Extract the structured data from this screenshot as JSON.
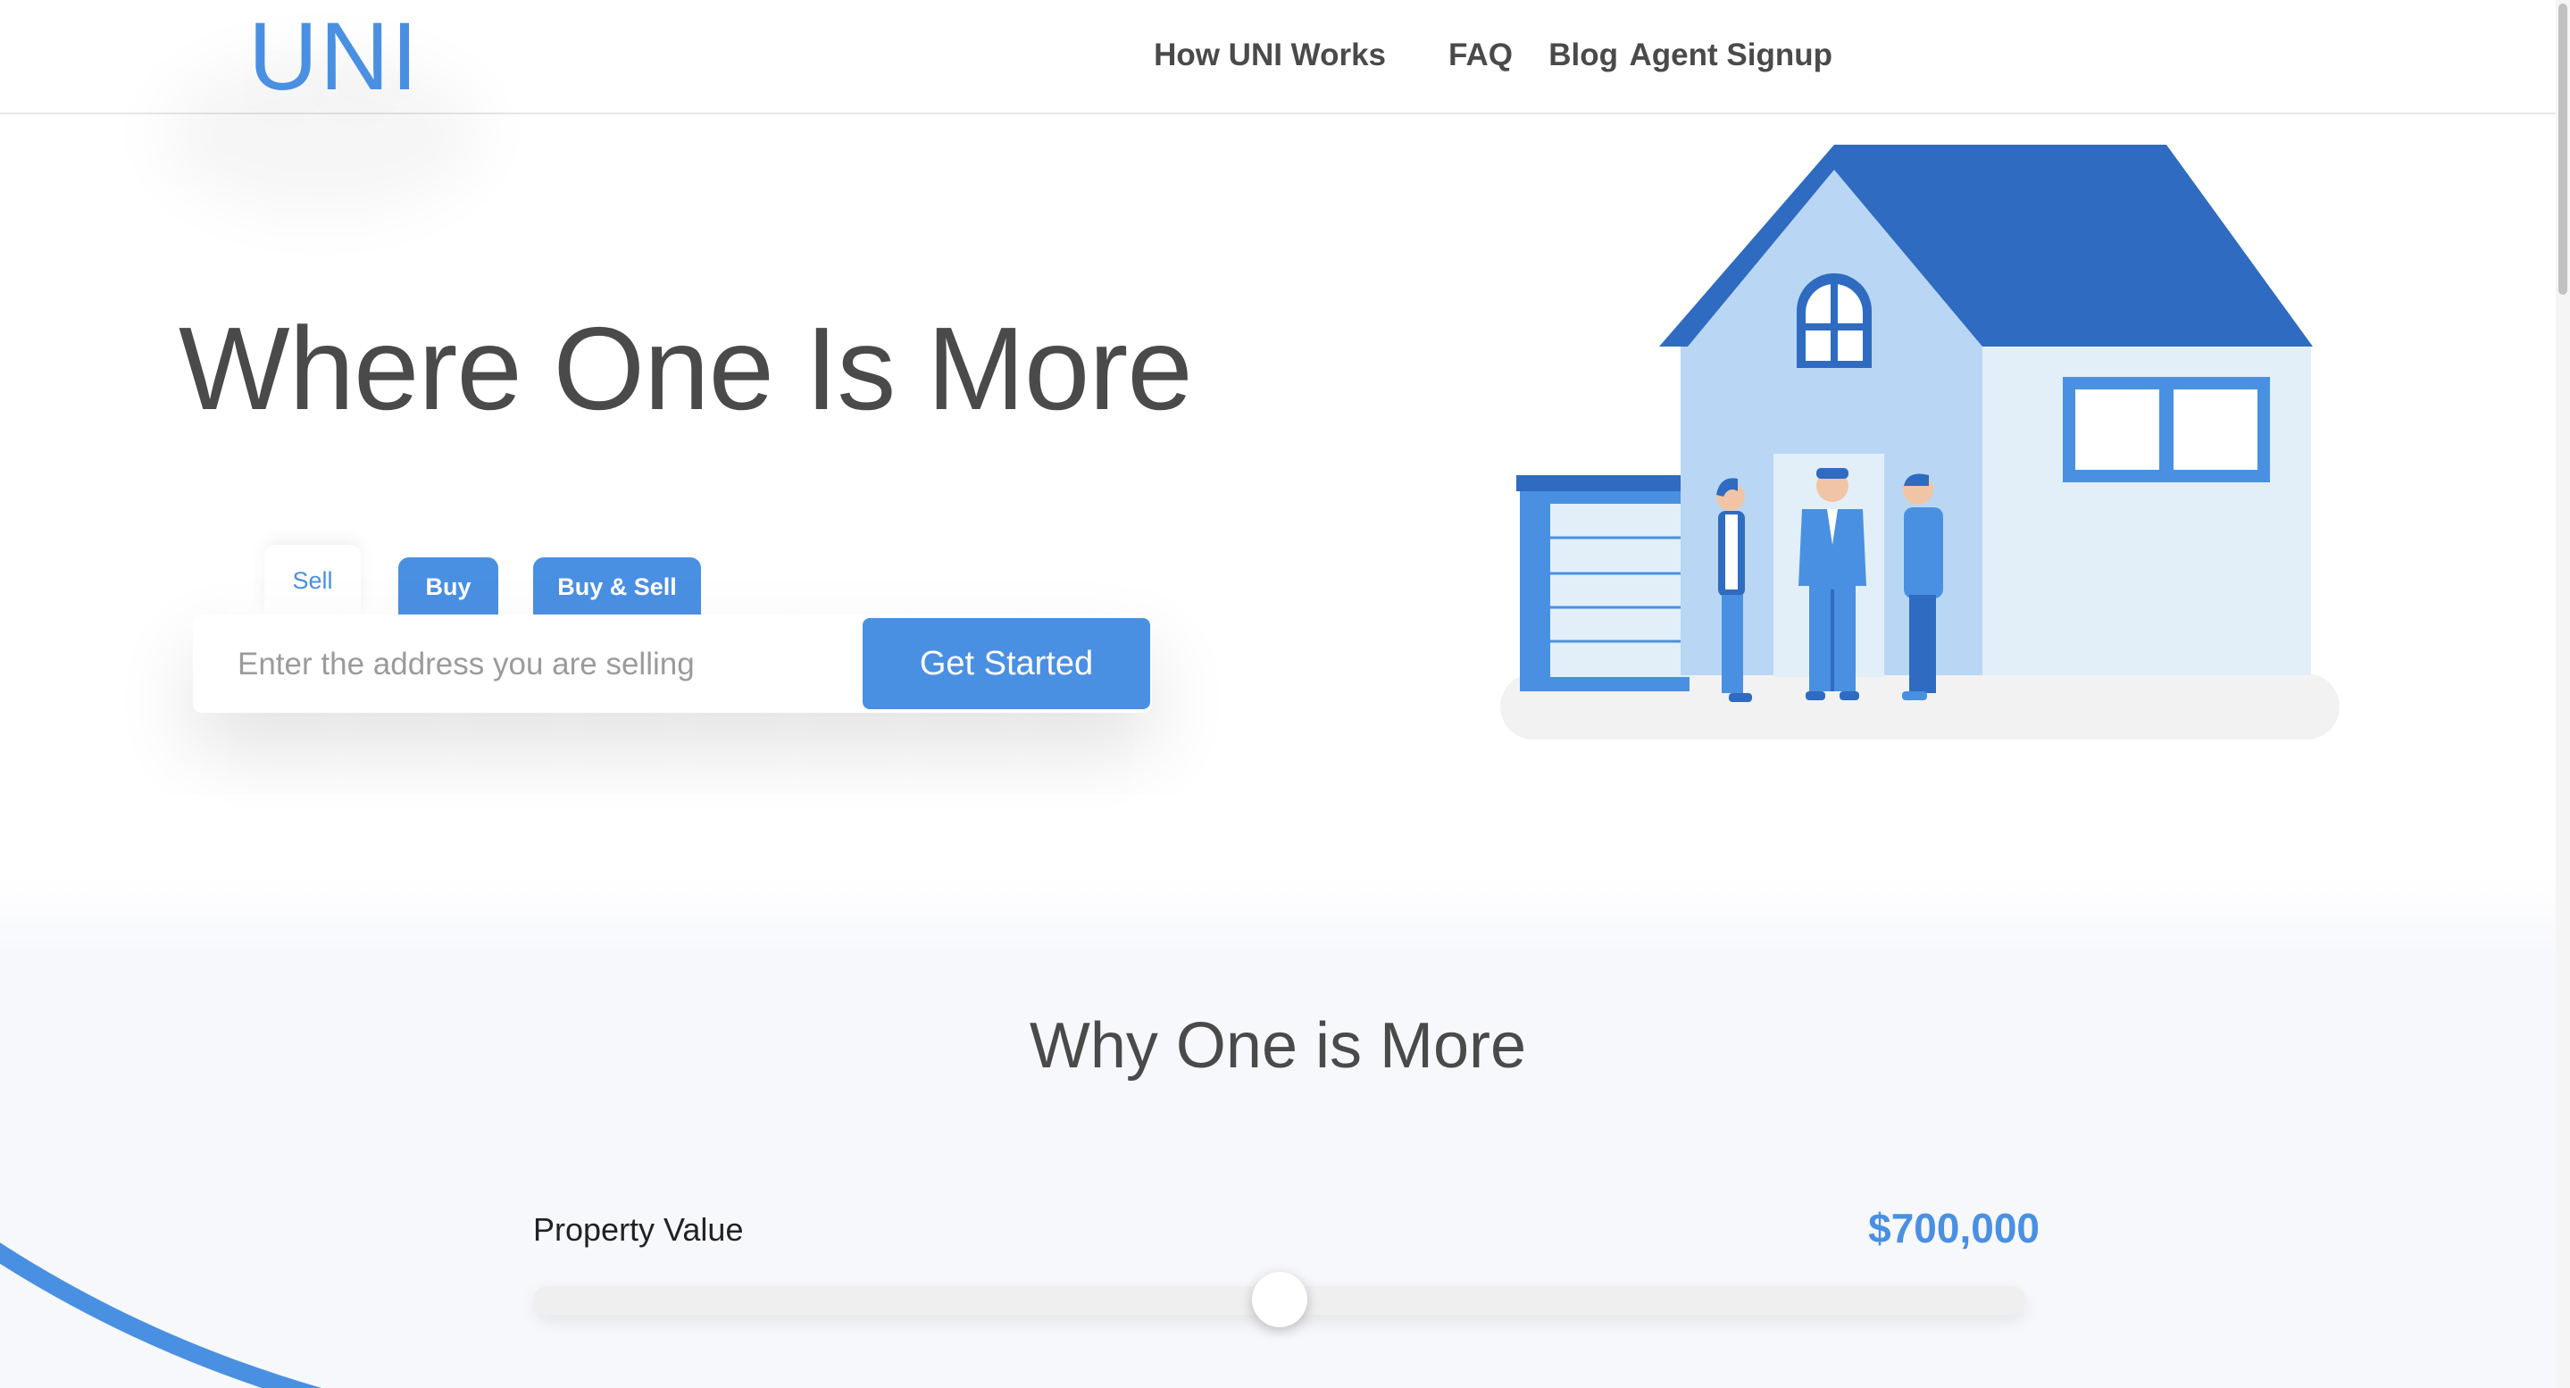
{
  "header": {
    "logo": "UNI",
    "nav": [
      {
        "label": "How UNI Works"
      },
      {
        "label": "FAQ"
      },
      {
        "label": "Blog"
      },
      {
        "label": "Agent Signup"
      }
    ]
  },
  "hero": {
    "title": "Where One Is More",
    "tabs": [
      {
        "label": "Sell",
        "active": true
      },
      {
        "label": "Buy",
        "active": false
      },
      {
        "label": "Buy & Sell",
        "active": false
      }
    ],
    "search": {
      "placeholder": "Enter the address you are selling",
      "value": ""
    },
    "cta_label": "Get Started"
  },
  "section2": {
    "title": "Why One is More",
    "property_label": "Property Value",
    "property_value": "$700,000",
    "slider_level_fraction": 0.5
  },
  "colors": {
    "accent": "#4a90e2",
    "roof": "#2f6bc1",
    "house_front": "#b9d7f5",
    "house_side": "#e2eff9"
  },
  "icons": [
    "house-illustration",
    "person-icon"
  ]
}
